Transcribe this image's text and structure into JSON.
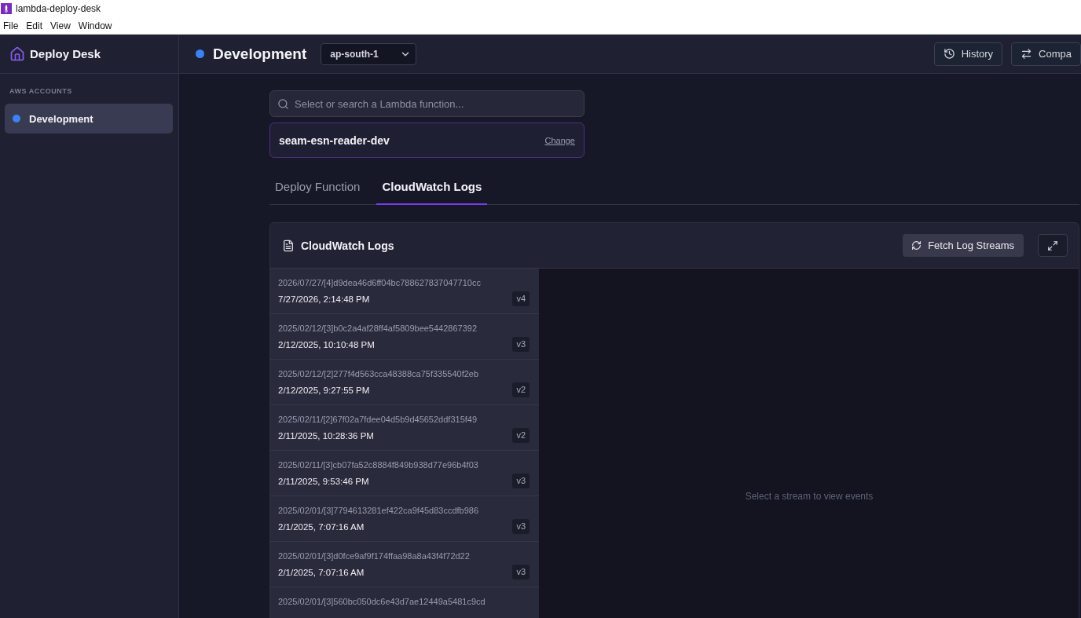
{
  "window": {
    "title": "lambda-deploy-desk"
  },
  "menu_bar": [
    "File",
    "Edit",
    "View",
    "Window"
  ],
  "sidebar": {
    "app_name": "Deploy Desk",
    "section_title": "AWS ACCOUNTS",
    "accounts": [
      {
        "name": "Development",
        "selected": true,
        "color": "#3b82f6"
      }
    ]
  },
  "header": {
    "account": "Development",
    "region": "ap-south-1",
    "buttons": [
      {
        "kind": "history",
        "label": "History"
      },
      {
        "kind": "compare",
        "label": "Compa"
      }
    ]
  },
  "function_search": {
    "placeholder": "Select or search a Lambda function..."
  },
  "selected_function": {
    "name": "seam-esn-reader-dev",
    "action": "Change"
  },
  "tabs": [
    {
      "label": "Deploy Function",
      "selected": false
    },
    {
      "label": "CloudWatch Logs",
      "selected": true
    }
  ],
  "logs_panel": {
    "title": "CloudWatch Logs",
    "fetch_button": "Fetch Log Streams",
    "streams": [
      {
        "name": "2026/07/27/[4]d9dea46d6ff04bc788627837047710cc",
        "time": "7/27/2026, 2:14:48 PM",
        "version": "v4",
        "selected": false
      },
      {
        "name": "2025/02/12/[3]b0c2a4af28ff4af5809bee5442867392",
        "time": "2/12/2025, 10:10:48 PM",
        "version": "v3",
        "selected": false
      },
      {
        "name": "2025/02/12/[2]277f4d563cca48388ca75f335540f2eb",
        "time": "2/12/2025, 9:27:55 PM",
        "version": "v2",
        "selected": false
      },
      {
        "name": "2025/02/11/[2]67f02a7fdee04d5b9d45652ddf315f49",
        "time": "2/11/2025, 10:28:36 PM",
        "version": "v2",
        "selected": false
      },
      {
        "name": "2025/02/11/[3]cb07fa52c8884f849b938d77e96b4f03",
        "time": "2/11/2025, 9:53:46 PM",
        "version": "v3",
        "selected": false
      },
      {
        "name": "2025/02/01/[3]7794613281ef422ca9f45d83ccdfb986",
        "time": "2/1/2025, 7:07:16 AM",
        "version": "v3",
        "selected": false
      },
      {
        "name": "2025/02/01/[3]d0fce9af9f174ffaa98a8a43f4f72d22",
        "time": "2/1/2025, 7:07:16 AM",
        "version": "v3",
        "selected": false
      },
      {
        "name": "2025/02/01/[3]560bc050dc6e43d7ae12449a5481c9cd",
        "selected": false
      }
    ],
    "empty_message": "Select a stream to view events"
  }
}
